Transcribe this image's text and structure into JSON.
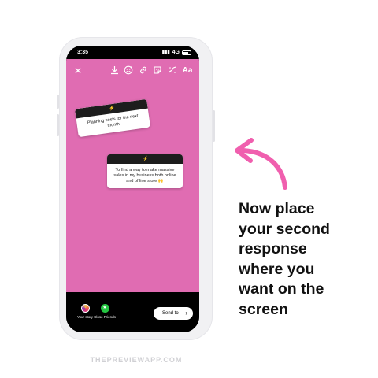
{
  "status_bar": {
    "time": "3:35",
    "network": "4G"
  },
  "toolbar": {
    "close_glyph": "✕",
    "text_tool_label": "Aa",
    "icons": [
      "download-icon",
      "face-filter-icon",
      "link-icon",
      "sticker-icon",
      "draw-icon"
    ]
  },
  "story": {
    "background_color": "#e06cb2",
    "responses": [
      {
        "text": "Planning posts for the next month"
      },
      {
        "text": "To find a way to make massive sales in my business both online and offline store 🙌"
      }
    ]
  },
  "bottom_bar": {
    "your_story_label": "Your story",
    "close_friends_label": "Close Friends",
    "send_to_label": "Send to"
  },
  "caption": {
    "lines": [
      "Now place",
      "your second",
      "response",
      "where you",
      "want on the",
      "screen"
    ]
  },
  "arrow_color": "#f05fae",
  "watermark": "THEPREVIEWAPP.COM"
}
